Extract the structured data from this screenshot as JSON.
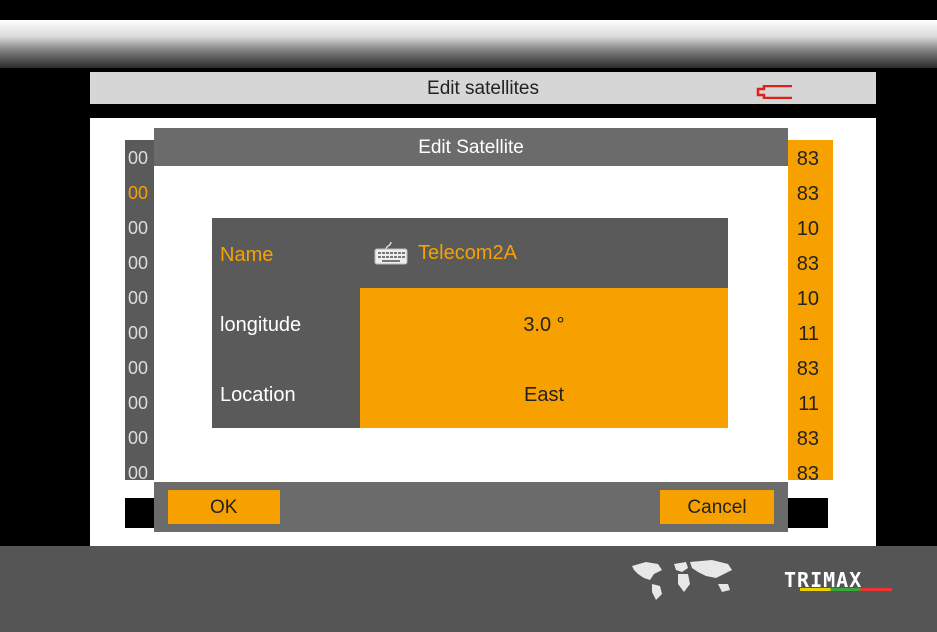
{
  "screen": {
    "title": "Edit satellites"
  },
  "background_list": {
    "left_column": [
      "00",
      "00",
      "00",
      "00",
      "00",
      "00",
      "00",
      "00",
      "00",
      "00"
    ],
    "highlighted_index": 1,
    "right_column": [
      "83",
      "83",
      "10",
      "83",
      "10",
      "11",
      "83",
      "11",
      "83",
      "83"
    ]
  },
  "dialog": {
    "title": "Edit Satellite",
    "fields": {
      "name_label": "Name",
      "name_value": "Telecom2A",
      "longitude_label": "longitude",
      "longitude_value": "3.0 °",
      "location_label": "Location",
      "location_value": "East"
    },
    "ok_label": "OK",
    "cancel_label": "Cancel"
  },
  "footer": {
    "brand": "TRIMAX"
  },
  "colors": {
    "accent": "#f7a100",
    "panel_gray": "#5a5a5a",
    "header_gray": "#6b6b6b",
    "battery_red": "#e0201a"
  },
  "icons": {
    "battery": "battery-icon",
    "keyboard": "keyboard-icon",
    "world_map": "world-map-icon"
  }
}
